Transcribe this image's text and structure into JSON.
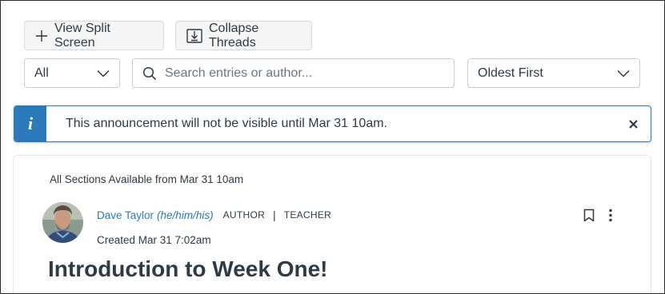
{
  "toolbar": {
    "split_label": "View Split Screen",
    "collapse_label": "Collapse Threads"
  },
  "filters": {
    "scope_value": "All",
    "search_placeholder": "Search entries or author...",
    "sort_value": "Oldest First"
  },
  "alert": {
    "icon_glyph": "i",
    "message": "This announcement will not be visible until Mar 31 10am."
  },
  "post": {
    "sections": "All Sections Available from Mar 31 10am",
    "author_name": "Dave Taylor",
    "pronouns": "(he/him/his)",
    "role_author": "AUTHOR",
    "role_separator": "|",
    "role_teacher": "TEACHER",
    "created": "Created Mar 31 7:02am",
    "title": "Introduction to Week One!"
  },
  "colors": {
    "accent": "#2b7abc",
    "text": "#2d3b45",
    "button_bg": "#f5f5f5"
  }
}
